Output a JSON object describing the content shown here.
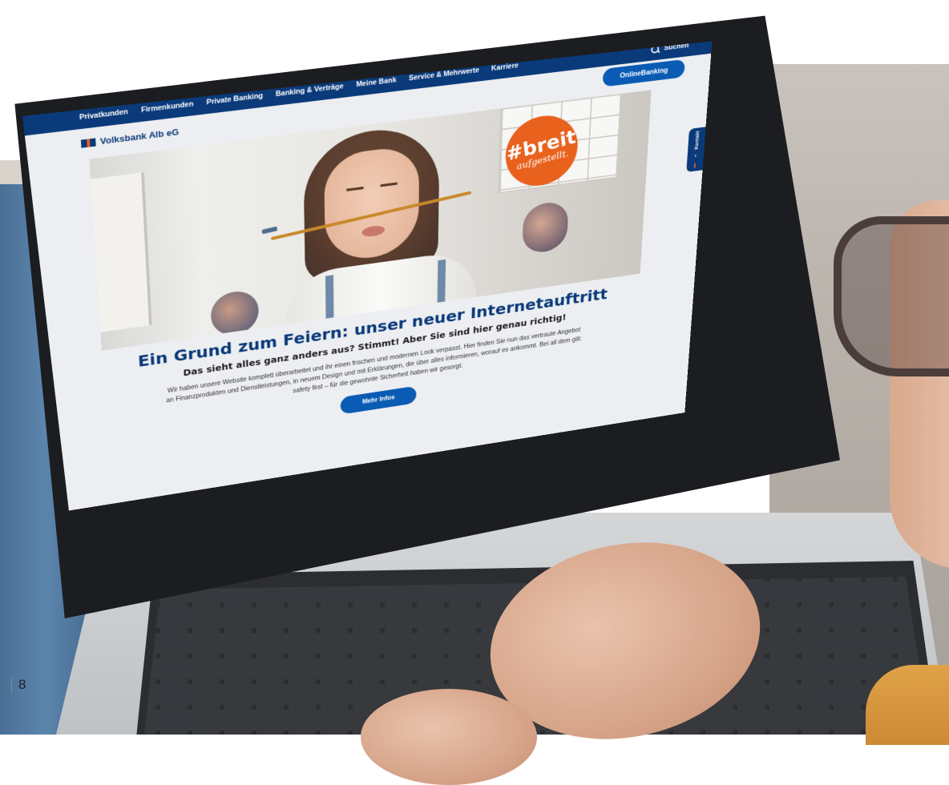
{
  "page_number": "8",
  "nav": {
    "items": [
      "Privatkunden",
      "Firmenkunden",
      "Private Banking",
      "Banking & Verträge",
      "Meine Bank",
      "Service & Mehrwerte",
      "Karriere"
    ],
    "search_label": "Suchen"
  },
  "header": {
    "logo_text": "Volksbank Alb eG",
    "online_banking": "OnlineBanking"
  },
  "hero": {
    "badge_main": "#breit",
    "badge_sub": "aufgestellt."
  },
  "kontakt": {
    "label": "Kontakt"
  },
  "content": {
    "headline": "Ein Grund zum Feiern: unser neuer Internetauftritt",
    "subheadline": "Das sieht alles ganz anders aus? Stimmt! Aber Sie sind hier genau richtig!",
    "body": "Wir haben unsere Website komplett überarbeitet und ihr einen frischen und modernen Look verpasst. Hier finden Sie nun das vertraute Angebot an Finanzprodukten und Dienstleistungen, in neuem Design und mit Erklärungen, die über alles informieren, worauf es ankommt. Bei all dem gilt: safety first – für die gewohnte Sicherheit haben wir gesorgt.",
    "button": "Mehr Infos"
  },
  "colors": {
    "brand_blue": "#0a3a7a",
    "button_blue": "#0a5bb4",
    "badge_orange": "#e8611d"
  }
}
